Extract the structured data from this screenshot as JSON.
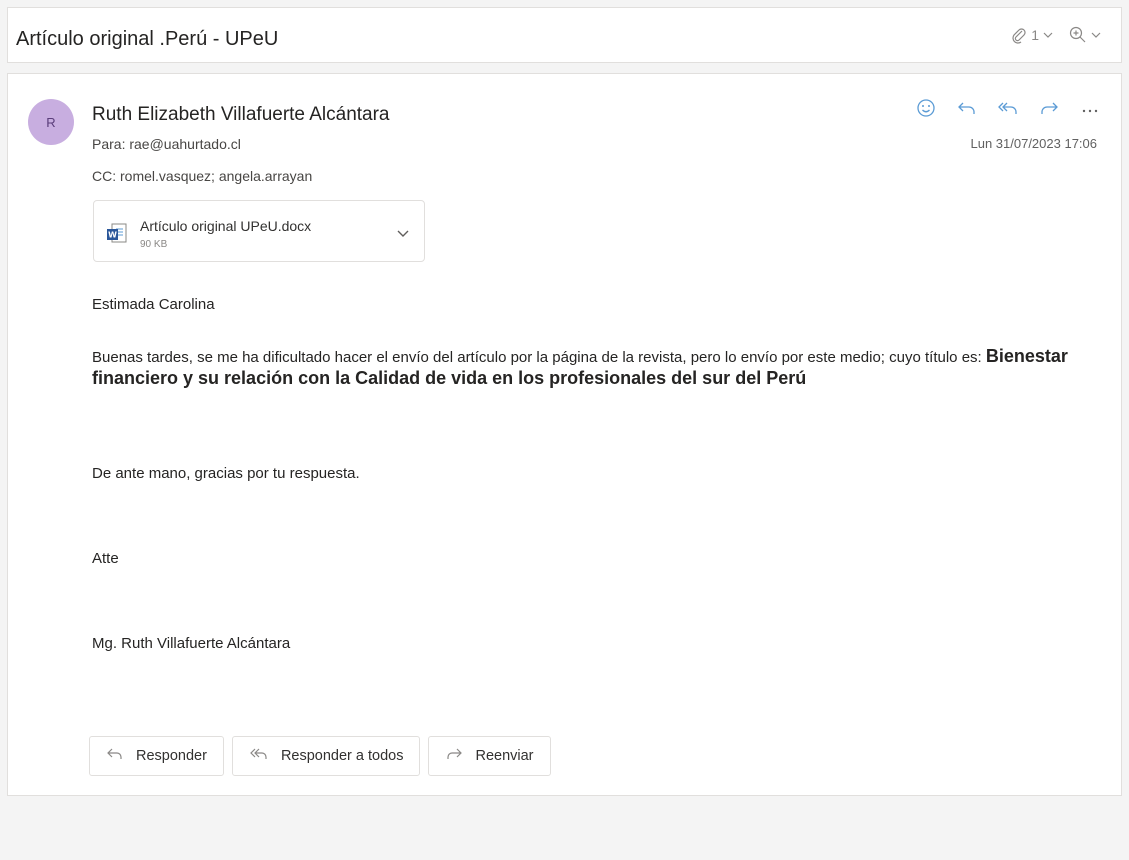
{
  "subject": {
    "title": "Artículo original .Perú - UPeU",
    "attachment_count": "1"
  },
  "message": {
    "avatar_initial": "R",
    "sender_name": "Ruth Elizabeth Villafuerte Alcántara",
    "to_label": "Para:",
    "to_value": "rae@uahurtado.cl",
    "cc_label": "CC:",
    "cc_value_1": "romel.vasquez;",
    "cc_value_2": "angela.arrayan",
    "date": "Lun 31/07/2023 17:06",
    "attachment": {
      "name": "Artículo original UPeU.docx",
      "size": "90 KB",
      "icon": "word-doc-icon"
    },
    "body": {
      "greeting": "Estimada Carolina",
      "line1": "Buenas tardes, se me ha dificultado hacer el envío del artículo por la página de la revista, pero lo envío por este medio;",
      "line2_prefix": "cuyo título es:",
      "title_bold": "Bienestar financiero y su relación con la Calidad de vida en los profesionales del sur del Perú",
      "thanks": "De ante mano, gracias por tu respuesta.",
      "closing": "Atte",
      "signature": "Mg. Ruth Villafuerte Alcántara"
    }
  },
  "reply_buttons": {
    "reply": "Responder",
    "reply_all": "Responder a todos",
    "forward": "Reenviar"
  },
  "colors": {
    "avatar_bg": "#c8aee0",
    "icon_blue": "#5b9bd5",
    "icon_gray": "#8a8886"
  }
}
